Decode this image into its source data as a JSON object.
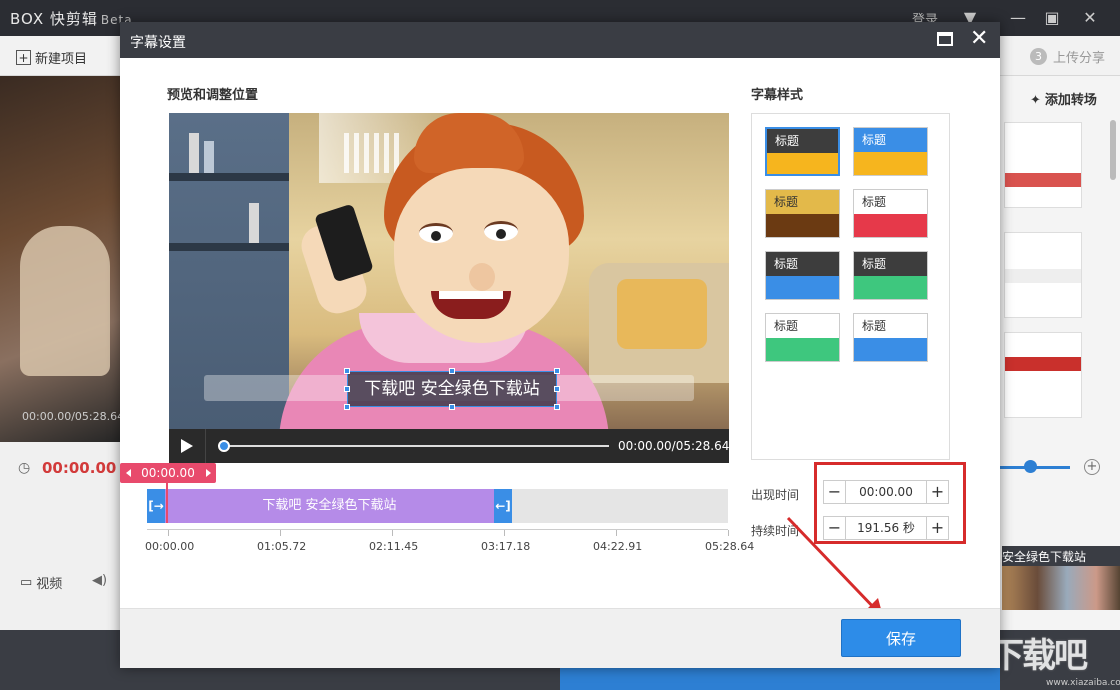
{
  "app": {
    "logo": "BOX 快剪辑",
    "beta": "Beta",
    "login": "登录",
    "new_project": "新建项目",
    "step3_number": "3",
    "step3_label": "上传分享",
    "add_transition": "添加转场",
    "preview_time": "00:00.00/05:28.64",
    "current_time": "00:00.00",
    "video_tab": "视频",
    "right_caption": "安全绿色下载站"
  },
  "dialog": {
    "title": "字幕设置",
    "preview_label": "预览和调整位置",
    "style_label": "字幕样式",
    "subtitle_text": "下载吧 安全绿色下载站",
    "player_time": "00:00.00/05:28.64",
    "marker_time": "00:00.00",
    "clip_text": "下载吧 安全绿色下载站",
    "ruler_ticks": [
      "00:00.00",
      "01:05.72",
      "02:11.45",
      "03:17.18",
      "04:22.91",
      "05:28.64"
    ],
    "styles": [
      {
        "label": "标题",
        "top_color": "#3d3d3d",
        "top_text_color": "#ffffff",
        "bottom_color": "#f6b51e",
        "selected": true
      },
      {
        "label": "标题",
        "top_color": "#3a8ee6",
        "top_text_color": "#ffffff",
        "bottom_color": "#f6b51e",
        "selected": false
      },
      {
        "label": "标题",
        "top_color": "#e3b94a",
        "top_text_color": "#333333",
        "bottom_color": "#6b3a12",
        "selected": false
      },
      {
        "label": "标题",
        "top_color": "#ffffff",
        "top_text_color": "#333333",
        "bottom_color": "#e6394a",
        "selected": false
      },
      {
        "label": "标题",
        "top_color": "#3d3d3d",
        "top_text_color": "#ffffff",
        "bottom_color": "#3a8ee6",
        "selected": false
      },
      {
        "label": "标题",
        "top_color": "#3d3d3d",
        "top_text_color": "#ffffff",
        "bottom_color": "#3ec77e",
        "selected": false
      },
      {
        "label": "标题",
        "top_color": "#ffffff",
        "top_text_color": "#333333",
        "bottom_color": "#3ec77e",
        "selected": false
      },
      {
        "label": "标题",
        "top_color": "#ffffff",
        "top_text_color": "#333333",
        "bottom_color": "#3a8ee6",
        "selected": false
      }
    ],
    "appear_label": "出现时间",
    "appear_value": "00:00.00",
    "duration_label": "持续时间",
    "duration_value": "191.56 秒",
    "save_button": "保存"
  },
  "watermark": {
    "text": "下载吧",
    "url": "www.xiazaiba.com"
  },
  "colors": {
    "accent": "#3a8ee6",
    "highlight": "#d62b2b",
    "marker": "#e84a6c",
    "clip": "#b58be8"
  }
}
